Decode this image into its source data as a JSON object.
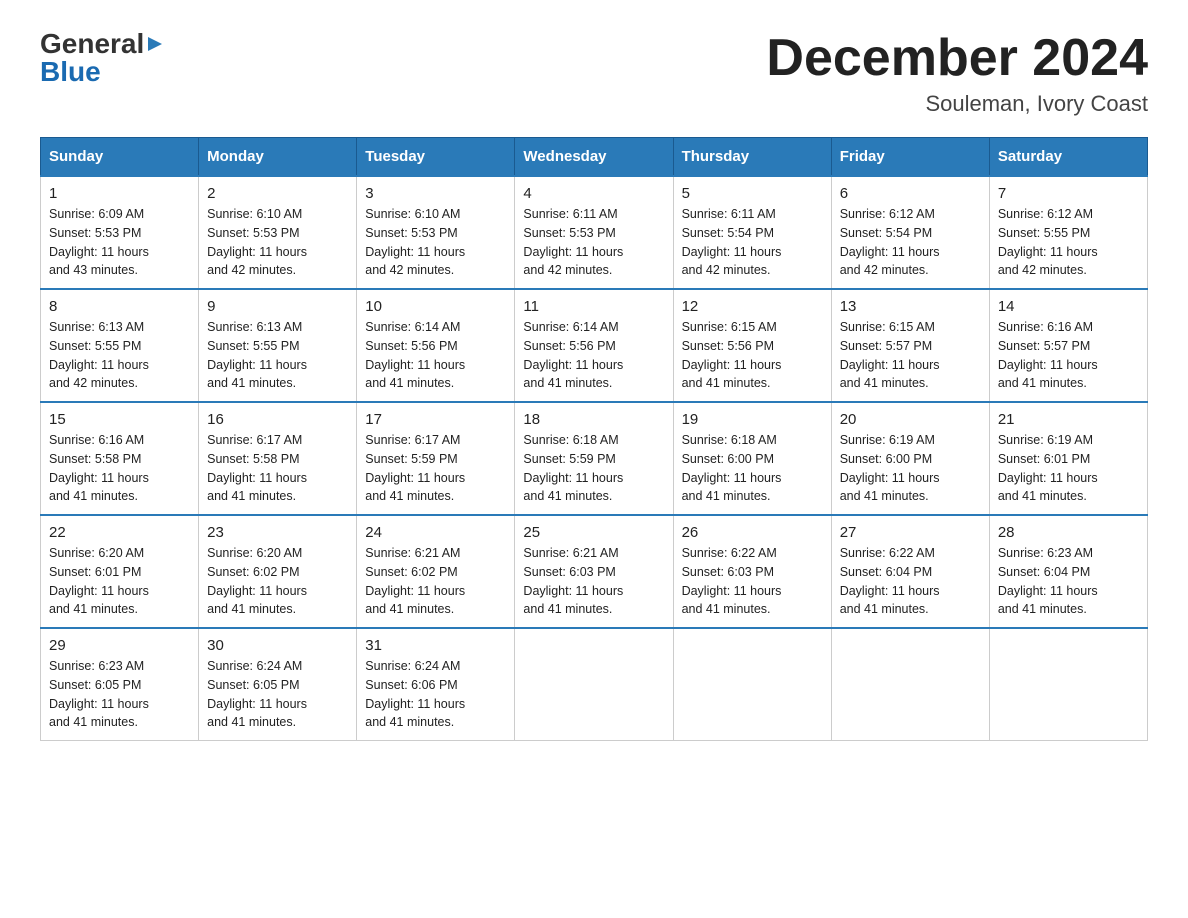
{
  "logo": {
    "general": "General",
    "blue": "Blue"
  },
  "title": {
    "month": "December 2024",
    "location": "Souleman, Ivory Coast"
  },
  "headers": [
    "Sunday",
    "Monday",
    "Tuesday",
    "Wednesday",
    "Thursday",
    "Friday",
    "Saturday"
  ],
  "weeks": [
    [
      {
        "day": "1",
        "sunrise": "6:09 AM",
        "sunset": "5:53 PM",
        "daylight": "11 hours and 43 minutes."
      },
      {
        "day": "2",
        "sunrise": "6:10 AM",
        "sunset": "5:53 PM",
        "daylight": "11 hours and 42 minutes."
      },
      {
        "day": "3",
        "sunrise": "6:10 AM",
        "sunset": "5:53 PM",
        "daylight": "11 hours and 42 minutes."
      },
      {
        "day": "4",
        "sunrise": "6:11 AM",
        "sunset": "5:53 PM",
        "daylight": "11 hours and 42 minutes."
      },
      {
        "day": "5",
        "sunrise": "6:11 AM",
        "sunset": "5:54 PM",
        "daylight": "11 hours and 42 minutes."
      },
      {
        "day": "6",
        "sunrise": "6:12 AM",
        "sunset": "5:54 PM",
        "daylight": "11 hours and 42 minutes."
      },
      {
        "day": "7",
        "sunrise": "6:12 AM",
        "sunset": "5:55 PM",
        "daylight": "11 hours and 42 minutes."
      }
    ],
    [
      {
        "day": "8",
        "sunrise": "6:13 AM",
        "sunset": "5:55 PM",
        "daylight": "11 hours and 42 minutes."
      },
      {
        "day": "9",
        "sunrise": "6:13 AM",
        "sunset": "5:55 PM",
        "daylight": "11 hours and 41 minutes."
      },
      {
        "day": "10",
        "sunrise": "6:14 AM",
        "sunset": "5:56 PM",
        "daylight": "11 hours and 41 minutes."
      },
      {
        "day": "11",
        "sunrise": "6:14 AM",
        "sunset": "5:56 PM",
        "daylight": "11 hours and 41 minutes."
      },
      {
        "day": "12",
        "sunrise": "6:15 AM",
        "sunset": "5:56 PM",
        "daylight": "11 hours and 41 minutes."
      },
      {
        "day": "13",
        "sunrise": "6:15 AM",
        "sunset": "5:57 PM",
        "daylight": "11 hours and 41 minutes."
      },
      {
        "day": "14",
        "sunrise": "6:16 AM",
        "sunset": "5:57 PM",
        "daylight": "11 hours and 41 minutes."
      }
    ],
    [
      {
        "day": "15",
        "sunrise": "6:16 AM",
        "sunset": "5:58 PM",
        "daylight": "11 hours and 41 minutes."
      },
      {
        "day": "16",
        "sunrise": "6:17 AM",
        "sunset": "5:58 PM",
        "daylight": "11 hours and 41 minutes."
      },
      {
        "day": "17",
        "sunrise": "6:17 AM",
        "sunset": "5:59 PM",
        "daylight": "11 hours and 41 minutes."
      },
      {
        "day": "18",
        "sunrise": "6:18 AM",
        "sunset": "5:59 PM",
        "daylight": "11 hours and 41 minutes."
      },
      {
        "day": "19",
        "sunrise": "6:18 AM",
        "sunset": "6:00 PM",
        "daylight": "11 hours and 41 minutes."
      },
      {
        "day": "20",
        "sunrise": "6:19 AM",
        "sunset": "6:00 PM",
        "daylight": "11 hours and 41 minutes."
      },
      {
        "day": "21",
        "sunrise": "6:19 AM",
        "sunset": "6:01 PM",
        "daylight": "11 hours and 41 minutes."
      }
    ],
    [
      {
        "day": "22",
        "sunrise": "6:20 AM",
        "sunset": "6:01 PM",
        "daylight": "11 hours and 41 minutes."
      },
      {
        "day": "23",
        "sunrise": "6:20 AM",
        "sunset": "6:02 PM",
        "daylight": "11 hours and 41 minutes."
      },
      {
        "day": "24",
        "sunrise": "6:21 AM",
        "sunset": "6:02 PM",
        "daylight": "11 hours and 41 minutes."
      },
      {
        "day": "25",
        "sunrise": "6:21 AM",
        "sunset": "6:03 PM",
        "daylight": "11 hours and 41 minutes."
      },
      {
        "day": "26",
        "sunrise": "6:22 AM",
        "sunset": "6:03 PM",
        "daylight": "11 hours and 41 minutes."
      },
      {
        "day": "27",
        "sunrise": "6:22 AM",
        "sunset": "6:04 PM",
        "daylight": "11 hours and 41 minutes."
      },
      {
        "day": "28",
        "sunrise": "6:23 AM",
        "sunset": "6:04 PM",
        "daylight": "11 hours and 41 minutes."
      }
    ],
    [
      {
        "day": "29",
        "sunrise": "6:23 AM",
        "sunset": "6:05 PM",
        "daylight": "11 hours and 41 minutes."
      },
      {
        "day": "30",
        "sunrise": "6:24 AM",
        "sunset": "6:05 PM",
        "daylight": "11 hours and 41 minutes."
      },
      {
        "day": "31",
        "sunrise": "6:24 AM",
        "sunset": "6:06 PM",
        "daylight": "11 hours and 41 minutes."
      },
      null,
      null,
      null,
      null
    ]
  ],
  "labels": {
    "sunrise": "Sunrise:",
    "sunset": "Sunset:",
    "daylight": "Daylight:"
  }
}
